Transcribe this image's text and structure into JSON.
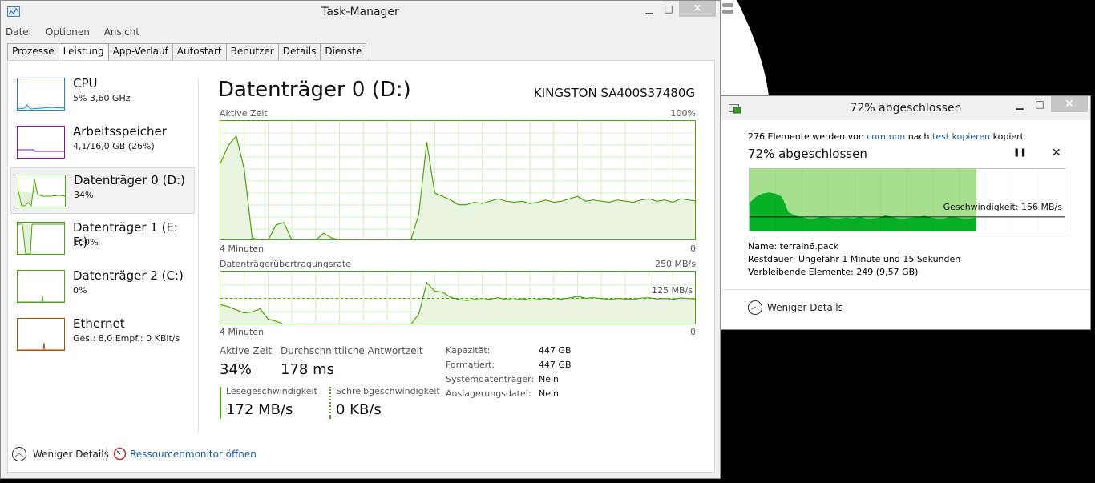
{
  "task_manager": {
    "title": "Task-Manager",
    "window_controls": {
      "minimize": "▁",
      "maximize": "□",
      "close": "✕"
    },
    "menu": [
      "Datei",
      "Optionen",
      "Ansicht"
    ],
    "tabs": [
      {
        "label": "Prozesse",
        "active": false
      },
      {
        "label": "Leistung",
        "active": true
      },
      {
        "label": "App-Verlauf",
        "active": false
      },
      {
        "label": "Autostart",
        "active": false
      },
      {
        "label": "Benutzer",
        "active": false
      },
      {
        "label": "Details",
        "active": false
      },
      {
        "label": "Dienste",
        "active": false
      }
    ],
    "sidebar": [
      {
        "name": "CPU",
        "value": "5% 3,60 GHz",
        "color": "#1c87c9"
      },
      {
        "name": "Arbeitsspeicher",
        "value": "4,1/16,0 GB (26%)",
        "color": "#8b12ae"
      },
      {
        "name": "Datenträger 0 (D:)",
        "value": "34%",
        "color": "#4da60c",
        "active": true
      },
      {
        "name": "Datenträger 1 (E: F:)",
        "value": "100%",
        "color": "#4da60c"
      },
      {
        "name": "Datenträger 2 (C:)",
        "value": "0%",
        "color": "#4da60c"
      },
      {
        "name": "Ethernet",
        "value": "Ges.: 8,0 Empf.: 0 KBit/s",
        "color": "#a7500f"
      }
    ],
    "detail": {
      "title": "Datenträger 0 (D:)",
      "model": "KINGSTON SA400S37480G",
      "graph1": {
        "label": "Aktive Zeit",
        "max_label": "100%",
        "time_label": "4 Minuten",
        "min_label": "0",
        "values": [
          65,
          80,
          88,
          60,
          2,
          0,
          0,
          13,
          15,
          0,
          0,
          0,
          0,
          6,
          2,
          0,
          0,
          0,
          0,
          0,
          0,
          0,
          0,
          0,
          0,
          22,
          83,
          40,
          37,
          34,
          30,
          30,
          32,
          31,
          33,
          35,
          33,
          32,
          33,
          31,
          32,
          34,
          32,
          33,
          35,
          37,
          33,
          34,
          33,
          32,
          34,
          33,
          32,
          34,
          35,
          33,
          34,
          32,
          35,
          34,
          33
        ]
      },
      "graph2": {
        "label": "Datenträgerübertragungsrate",
        "max_label": "250 MB/s",
        "mid_label": "125 MB/s",
        "time_label": "4 Minuten",
        "min_label": "0",
        "values": [
          95,
          85,
          70,
          55,
          60,
          75,
          25,
          15,
          0,
          0,
          0,
          0,
          0,
          0,
          0,
          0,
          0,
          0,
          0,
          0,
          0,
          0,
          0,
          0,
          0,
          50,
          200,
          160,
          155,
          130,
          120,
          115,
          120,
          118,
          122,
          128,
          120,
          118,
          123,
          117,
          120,
          125,
          118,
          122,
          127,
          135,
          125,
          128,
          124,
          120,
          125,
          122,
          120,
          126,
          128,
          122,
          125,
          120,
          127,
          124,
          122
        ]
      },
      "stats": {
        "active_time_label": "Aktive Zeit",
        "active_time_value": "34%",
        "response_label": "Durchschnittliche Antwortzeit",
        "response_value": "178 ms",
        "read_label": "Lesegeschwindigkeit",
        "read_value": "172 MB/s",
        "write_label": "Schreibgeschwindigkeit",
        "write_value": "0 KB/s"
      },
      "info": [
        {
          "label": "Kapazität:",
          "value": "447 GB"
        },
        {
          "label": "Formatiert:",
          "value": "447 GB"
        },
        {
          "label": "Systemdatenträger:",
          "value": "Nein"
        },
        {
          "label": "Auslagerungsdatei:",
          "value": "Nein"
        }
      ]
    },
    "footer": {
      "fewer_details": "Weniger Details",
      "resource_monitor": "Ressourcenmonitor öffnen"
    }
  },
  "copy_dialog": {
    "title": "72% abgeschlossen",
    "window_controls": {
      "minimize": "▁",
      "maximize": "□",
      "close": "✕"
    },
    "line_prefix": "276 Elemente werden von",
    "source": "common",
    "line_mid": "nach",
    "destination": "test kopieren",
    "line_suffix": "kopiert",
    "heading": "72% abgeschlossen",
    "pause_icon": "❚❚",
    "cancel_icon": "✕",
    "progress": 0.72,
    "speed_label": "Geschwindigkeit: 156 MB/s",
    "speed_history": [
      0.45,
      0.55,
      0.6,
      0.62,
      0.6,
      0.55,
      0.3,
      0.25,
      0.22,
      0.2,
      0.2,
      0.22,
      0.21,
      0.2,
      0.2,
      0.21,
      0.2,
      0.22,
      0.2,
      0.2,
      0.21,
      0.25,
      0.22,
      0.2,
      0.2,
      0.21,
      0.22,
      0.24,
      0.21,
      0.2,
      0.2,
      0.22,
      0.21,
      0.2,
      0.2,
      0.21
    ],
    "name_label": "Name:",
    "name_value": "terrain6.pack",
    "remaining_label": "Restdauer:",
    "remaining_value": "Ungefähr 1 Minute und 15 Sekunden",
    "items_label": "Verbleibende Elemente:",
    "items_value": "249 (9,57 GB)",
    "fewer_details": "Weniger Details"
  }
}
